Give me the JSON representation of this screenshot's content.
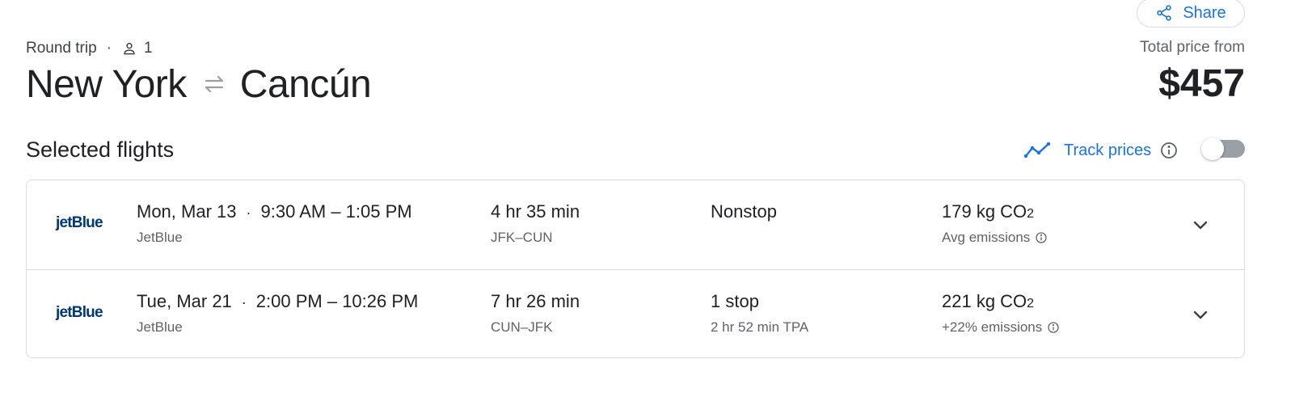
{
  "header": {
    "share_label": "Share",
    "trip_type": "Round trip",
    "dot": "·",
    "passengers": "1",
    "origin": "New York",
    "destination": "Cancún",
    "price_label": "Total price from",
    "price": "$457"
  },
  "section": {
    "title": "Selected flights",
    "track_label": "Track prices",
    "track_enabled": false
  },
  "flights": [
    {
      "airline_logo": "jetBlue",
      "date": "Mon, Mar 13",
      "dot": "·",
      "times": "9:30 AM – 1:05 PM",
      "airline": "JetBlue",
      "duration": "4 hr 35 min",
      "route": "JFK–CUN",
      "stops": "Nonstop",
      "layover": "",
      "co2_value": "179 kg CO",
      "co2_sub": "2",
      "emissions": "Avg emissions"
    },
    {
      "airline_logo": "jetBlue",
      "date": "Tue, Mar 21",
      "dot": "·",
      "times": "2:00 PM – 10:26 PM",
      "airline": "JetBlue",
      "duration": "7 hr 26 min",
      "route": "CUN–JFK",
      "stops": "1 stop",
      "layover": "2 hr 52 min TPA",
      "co2_value": "221 kg CO",
      "co2_sub": "2",
      "emissions": "+22% emissions"
    }
  ],
  "colors": {
    "accent": "#1a73e8",
    "text": "#202124",
    "secondary": "#5f6368",
    "border": "#dadce0",
    "jetblue": "#003876"
  },
  "icons": {
    "share": "share-icon",
    "passenger": "person-icon",
    "swap": "swap-arrows-icon",
    "trend": "trend-line-icon",
    "info": "info-icon",
    "expand": "chevron-down-icon"
  }
}
